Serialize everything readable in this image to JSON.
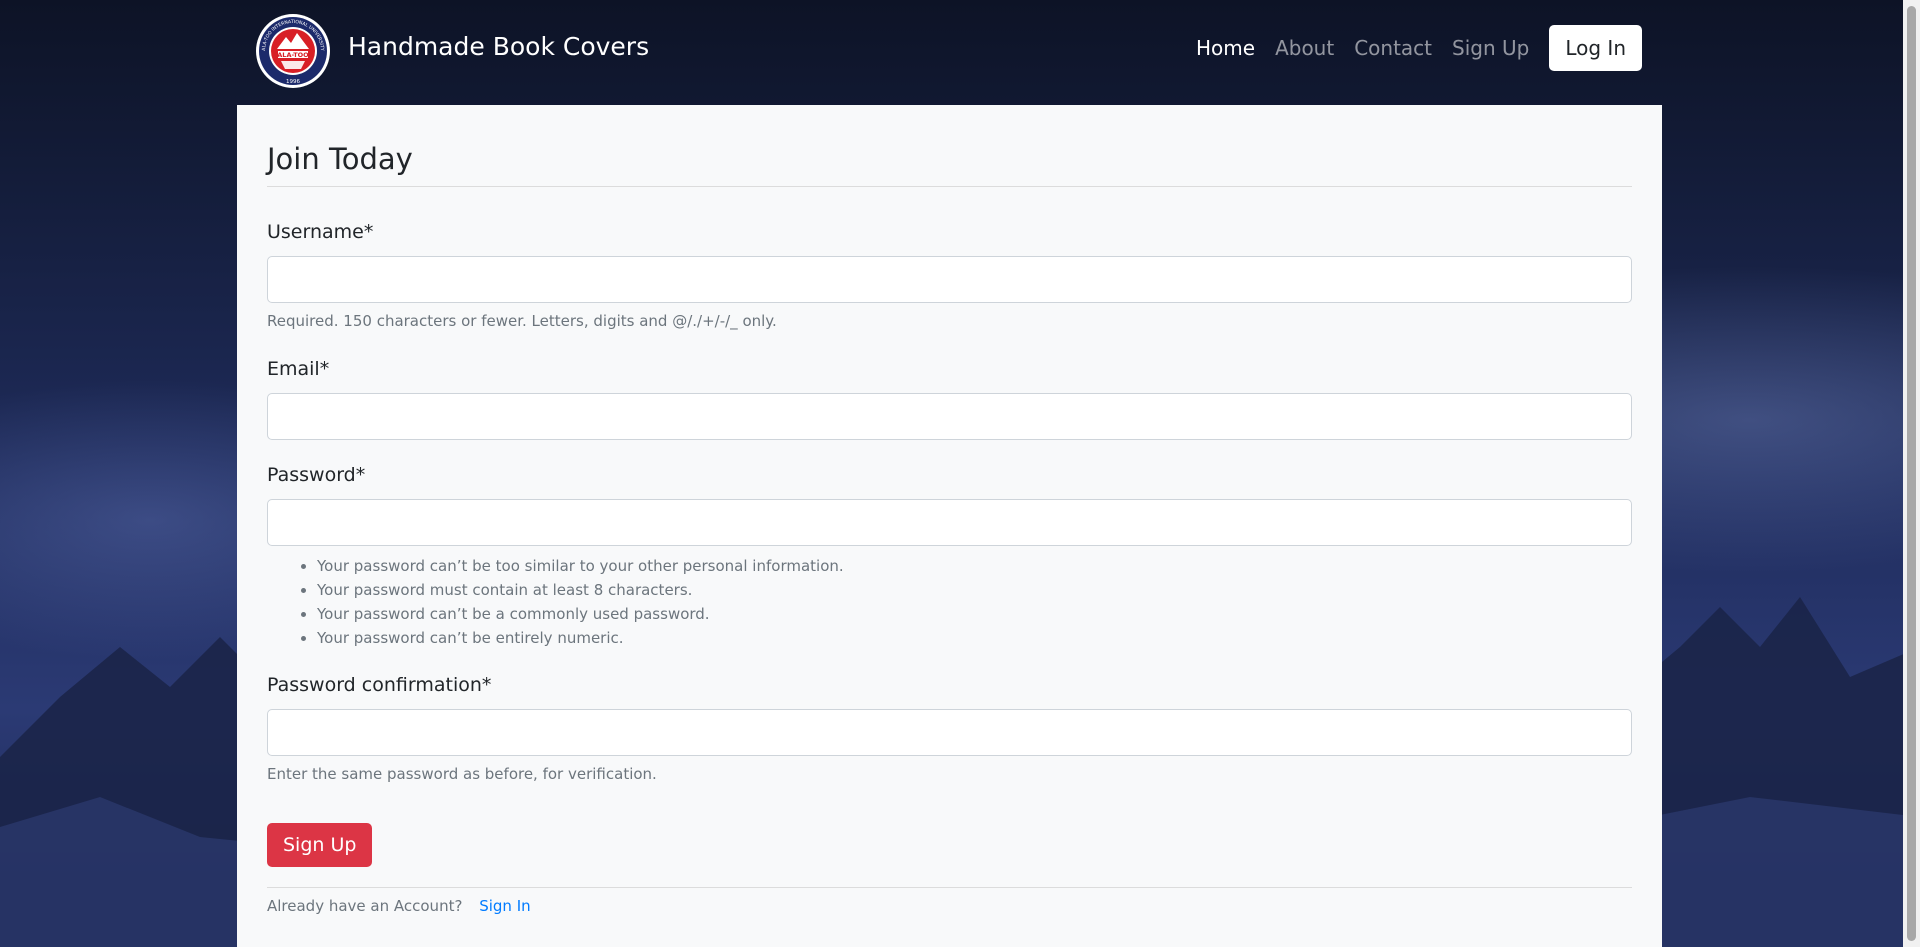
{
  "navbar": {
    "brand": "Handmade Book Covers",
    "logo": {
      "top_text": "ALA-TOO INTERNATIONAL UNIVERSITY",
      "center_text": "ALA-TOO",
      "year": "1996"
    },
    "links": [
      {
        "label": "Home",
        "active": true
      },
      {
        "label": "About",
        "active": false
      },
      {
        "label": "Contact",
        "active": false
      },
      {
        "label": "Sign Up",
        "active": false
      }
    ],
    "login_label": "Log In"
  },
  "form": {
    "legend": "Join Today",
    "username": {
      "label": "Username*",
      "value": "",
      "help": "Required. 150 characters or fewer. Letters, digits and @/./+/-/_ only."
    },
    "email": {
      "label": "Email*",
      "value": ""
    },
    "password": {
      "label": "Password*",
      "value": "",
      "help_items": [
        "Your password can’t be too similar to your other personal information.",
        "Your password must contain at least 8 characters.",
        "Your password can’t be a commonly used password.",
        "Your password can’t be entirely numeric."
      ]
    },
    "password_confirmation": {
      "label": "Password confirmation*",
      "value": "",
      "help": "Enter the same password as before, for verification."
    },
    "submit_label": "Sign Up"
  },
  "footer": {
    "prompt": "Already have an Account?",
    "signin_label": "Sign In"
  },
  "colors": {
    "accent_button": "#dc3545",
    "link": "#007bff",
    "card_bg": "#f8f9fa"
  }
}
